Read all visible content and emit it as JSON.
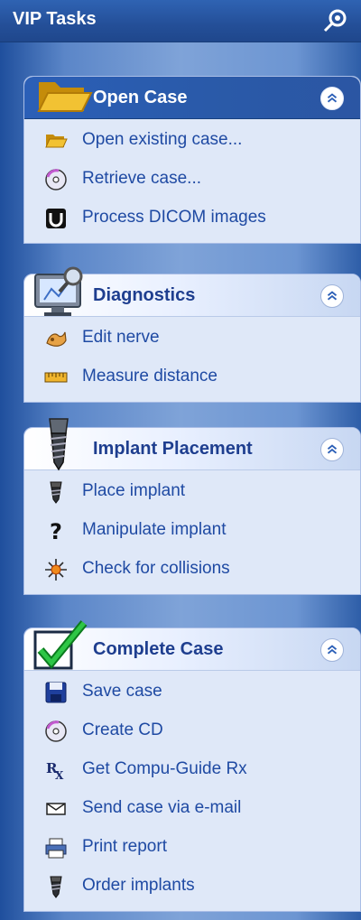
{
  "header": {
    "title": "VIP Tasks"
  },
  "panels": [
    {
      "title": "Open Case",
      "items": [
        {
          "label": "Open existing case...",
          "icon": "open-folder-icon"
        },
        {
          "label": "Retrieve case...",
          "icon": "cd-icon"
        },
        {
          "label": "Process DICOM images",
          "icon": "dicom-icon"
        }
      ]
    },
    {
      "title": "Diagnostics",
      "items": [
        {
          "label": "Edit nerve",
          "icon": "nerve-icon"
        },
        {
          "label": "Measure distance",
          "icon": "ruler-icon"
        }
      ]
    },
    {
      "title": "Implant Placement",
      "items": [
        {
          "label": "Place implant",
          "icon": "implant-icon"
        },
        {
          "label": "Manipulate implant",
          "icon": "question-icon"
        },
        {
          "label": "Check for collisions",
          "icon": "collision-icon"
        }
      ]
    },
    {
      "title": "Complete Case",
      "items": [
        {
          "label": "Save case",
          "icon": "floppy-disk-icon"
        },
        {
          "label": "Create CD",
          "icon": "cd-icon"
        },
        {
          "label": "Get Compu-Guide Rx",
          "icon": "rx-icon"
        },
        {
          "label": "Send case via e-mail",
          "icon": "envelope-icon"
        },
        {
          "label": "Print report",
          "icon": "printer-icon"
        },
        {
          "label": "Order implants",
          "icon": "implant-icon"
        }
      ]
    }
  ]
}
